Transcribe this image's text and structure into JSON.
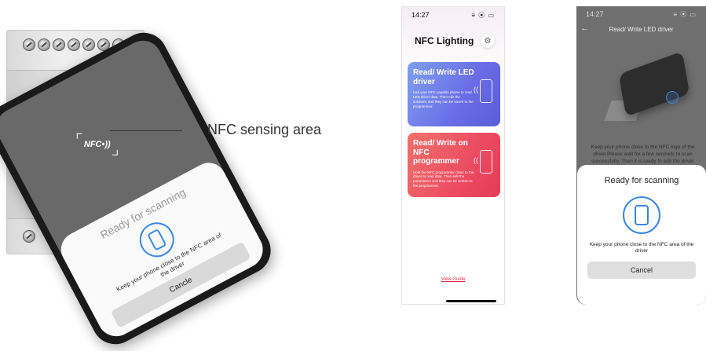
{
  "figure1": {
    "nfc_logo": "NFC•))",
    "callout": "NFC sensing area",
    "sheet_title": "Ready for scanning",
    "sheet_message": "Keep your phone close to the NFC area of the driver",
    "button_label": "Cancle"
  },
  "figure2": {
    "status_time": "14:27",
    "status_icons": "≡ ⦿ ▭",
    "title": "NFC Lighting",
    "settings_icon": "gear-icon",
    "cards": [
      {
        "title": "Read/ Write LED driver",
        "description": "Use your NFC-capable phone to read LED driver data. Then edit the solutions and they can be saved to the programmer.",
        "color": "#6a6ce6"
      },
      {
        "title": "Read/ Write on NFC programmer",
        "description": "Hold the NFC programmer close to the driver to read data. Then edit the parameters and they can be written to the programmer.",
        "color": "#ec4c62"
      }
    ],
    "view_guide": "View Guide"
  },
  "figure3": {
    "status_time": "14:27",
    "status_icons": "≡ ⦿ ▭",
    "back_icon": "←",
    "title": "Read/ Write LED driver",
    "hint": "Keep your phone close to the NFC logo of the driver.Please wait for a few seconds to scan successfully. Then it is ready to edit the driver",
    "sheet_title": "Ready for scanning",
    "sheet_message": "Keep your phone close to the NFC area of the driver",
    "button_label": "Cancel"
  },
  "accent_blue": "#3a86e0"
}
